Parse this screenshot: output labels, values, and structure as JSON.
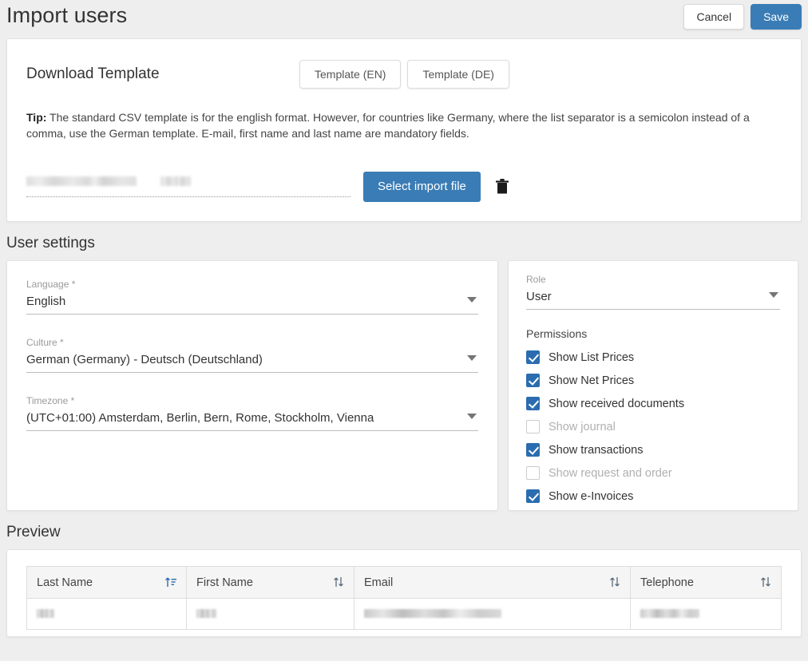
{
  "header": {
    "title": "Import users",
    "cancel_label": "Cancel",
    "save_label": "Save"
  },
  "import_card": {
    "download_title": "Download Template",
    "template_en_label": "Template (EN)",
    "template_de_label": "Template (DE)",
    "tip_prefix": "Tip:",
    "tip_text": " The standard CSV template is for the english format. However, for countries like Germany, where the list separator is a semicolon instead of a comma, use the German template. E-mail, first name and last name are mandatory fields.",
    "file_name": "",
    "select_file_label": "Select import file",
    "delete_icon": "trash-icon"
  },
  "user_settings": {
    "section_title": "User settings",
    "fields": [
      {
        "label": "Language *",
        "value": "English"
      },
      {
        "label": "Culture *",
        "value": "German (Germany) - Deutsch (Deutschland)"
      },
      {
        "label": "Timezone *",
        "value": "(UTC+01:00) Amsterdam, Berlin, Bern, Rome, Stockholm, Vienna"
      }
    ],
    "role": {
      "label": "Role",
      "value": "User"
    },
    "permissions_title": "Permissions",
    "permissions": [
      {
        "label": "Show List Prices",
        "checked": true,
        "disabled": false
      },
      {
        "label": "Show Net Prices",
        "checked": true,
        "disabled": false
      },
      {
        "label": "Show received documents",
        "checked": true,
        "disabled": false
      },
      {
        "label": "Show journal",
        "checked": false,
        "disabled": true
      },
      {
        "label": "Show transactions",
        "checked": true,
        "disabled": false
      },
      {
        "label": "Show request and order",
        "checked": false,
        "disabled": true
      },
      {
        "label": "Show e-Invoices",
        "checked": true,
        "disabled": false
      }
    ]
  },
  "preview": {
    "section_title": "Preview",
    "columns": [
      {
        "label": "Last Name",
        "sort": "asc-alpha"
      },
      {
        "label": "First Name",
        "sort": "none"
      },
      {
        "label": "Email",
        "sort": "none"
      },
      {
        "label": "Telephone",
        "sort": "none"
      }
    ],
    "rows": [
      {
        "last_name": "",
        "first_name": "",
        "email": "",
        "telephone": ""
      }
    ]
  },
  "colors": {
    "accent": "#3a7cb5",
    "checkbox": "#2b6cb0",
    "page_bg": "#eeeeee",
    "card_bg": "#ffffff"
  }
}
